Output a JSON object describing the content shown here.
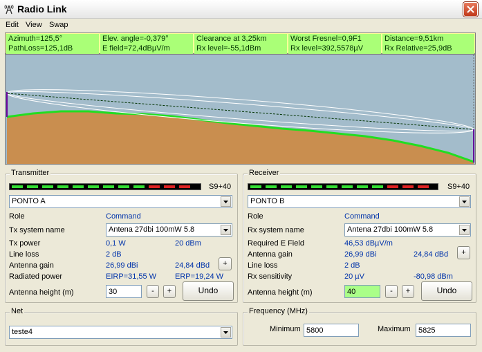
{
  "window": {
    "title": "Radio Link",
    "close_label": "X"
  },
  "menu": [
    "Edit",
    "View",
    "Swap"
  ],
  "info": {
    "row1": [
      "Azimuth=125,5°",
      "Elev. angle=-0,379°",
      "Clearance at 3,25km",
      "Worst Fresnel=0,9F1",
      "Distance=9,51km"
    ],
    "row2": [
      "PathLoss=125,1dB",
      "E field=72,4dBµV/m",
      "Rx level=-55,1dBm",
      "Rx level=392,5578µV",
      "Rx Relative=25,9dB"
    ]
  },
  "profile_colors": {
    "sky": "#a3bccb",
    "terrain": "#c98e4f",
    "terrain_line": "#22dd22",
    "fresnel": "#ffffff",
    "los": "#003300",
    "antenna": "#660099"
  },
  "transmitter": {
    "title": "Transmitter",
    "signal_label": "S9+40",
    "site": "PONTO A",
    "role_label": "Role",
    "role_value": "Command",
    "system_label": "Tx system name",
    "system_value": "Antena 27dbi 100mW 5.8",
    "power_label": "Tx power",
    "power_w": "0,1 W",
    "power_dbm": "20 dBm",
    "lineloss_label": "Line loss",
    "lineloss_value": "2 dB",
    "gain_label": "Antenna gain",
    "gain_dbi": "26,99 dBi",
    "gain_dbd": "24,84 dBd",
    "radiated_label": "Radiated power",
    "eirp": "EIRP=31,55 W",
    "erp": "ERP=19,24 W",
    "height_label": "Antenna height (m)",
    "height_value": "30",
    "minus": "-",
    "plus": "+",
    "undo": "Undo"
  },
  "receiver": {
    "title": "Receiver",
    "signal_label": "S9+40",
    "site": "PONTO B",
    "role_label": "Role",
    "role_value": "Command",
    "system_label": "Rx system name",
    "system_value": "Antena 27dbi 100mW 5.8",
    "efield_label": "Required E Field",
    "efield_value": "46,53 dBµV/m",
    "gain_label": "Antenna gain",
    "gain_dbi": "26,99 dBi",
    "gain_dbd": "24,84 dBd",
    "lineloss_label": "Line loss",
    "lineloss_value": "2 dB",
    "sens_label": "Rx sensitivity",
    "sens_uv": "20 µV",
    "sens_dbm": "-80,98 dBm",
    "height_label": "Antenna height (m)",
    "height_value": "40",
    "minus": "-",
    "plus": "+",
    "undo": "Undo"
  },
  "net": {
    "title": "Net",
    "value": "teste4"
  },
  "frequency": {
    "title": "Frequency (MHz)",
    "min_label": "Minimum",
    "min_value": "5800",
    "max_label": "Maximum",
    "max_value": "5825"
  }
}
